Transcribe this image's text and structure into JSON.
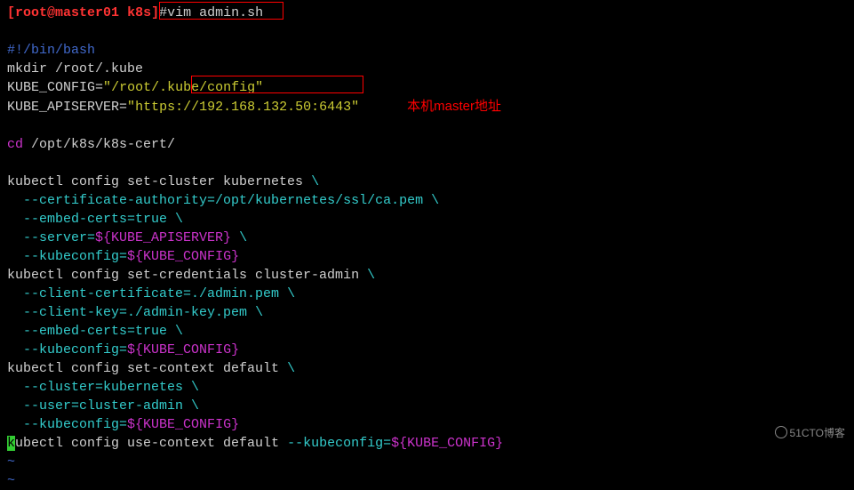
{
  "prompt": {
    "user": "root",
    "at": "@",
    "host": "master01",
    "dir": " k8s",
    "bracket_close": "]",
    "hash": "#",
    "command": "vim admin.sh"
  },
  "annotation": "本机master地址",
  "script": {
    "shebang": "#!/bin/bash",
    "mkdir": "mkdir /root/.kube",
    "kube_config_assign": {
      "var": "KUBE_CONFIG",
      "eq": "=",
      "q1": "\"",
      "val": "/root/.kube/config",
      "q2": "\""
    },
    "kube_apiserver_assign": {
      "var": "KUBE_APISERVER",
      "eq": "=",
      "q1": "\"",
      "proto": "https://",
      "addr": "192.168.132.50:6443",
      "q2": "\""
    },
    "cd": {
      "cmd": "cd",
      "path": " /opt/k8s/k8s-cert/"
    },
    "cluster": {
      "l1": {
        "cmd": "kubectl config set-cluster kubernetes ",
        "bs": "\\"
      },
      "l2": {
        "pad": "  ",
        "opt": "--certificate-authority=/opt/kubernetes/ssl/ca.pem ",
        "bs": "\\"
      },
      "l3": {
        "pad": "  ",
        "opt": "--embed-certs=true ",
        "bs": "\\"
      },
      "l4": {
        "pad": "  ",
        "opt": "--server=",
        "var": "${KUBE_APISERVER}",
        "sp": " ",
        "bs": "\\"
      },
      "l5": {
        "pad": "  ",
        "opt": "--kubeconfig=",
        "var": "${KUBE_CONFIG}"
      }
    },
    "creds": {
      "l1": {
        "cmd": "kubectl config set-credentials cluster-admin ",
        "bs": "\\"
      },
      "l2": {
        "pad": "  ",
        "opt": "--client-certificate=./admin.pem ",
        "bs": "\\"
      },
      "l3": {
        "pad": "  ",
        "opt": "--client-key=./admin-key.pem ",
        "bs": "\\"
      },
      "l4": {
        "pad": "  ",
        "opt": "--embed-certs=true ",
        "bs": "\\"
      },
      "l5": {
        "pad": "  ",
        "opt": "--kubeconfig=",
        "var": "${KUBE_CONFIG}"
      }
    },
    "context": {
      "l1": {
        "cmd": "kubectl config set-context default ",
        "bs": "\\"
      },
      "l2": {
        "pad": "  ",
        "opt": "--cluster=kubernetes ",
        "bs": "\\"
      },
      "l3": {
        "pad": "  ",
        "opt": "--user=cluster-admin ",
        "bs": "\\"
      },
      "l4": {
        "pad": "  ",
        "opt": "--kubeconfig=",
        "var": "${KUBE_CONFIG}"
      }
    },
    "use_context": {
      "cursor": "k",
      "cmd": "ubectl config use-context default ",
      "opt": "--kubeconfig=",
      "var": "${KUBE_CONFIG}"
    }
  },
  "tilde": "~",
  "watermark": "51CTO博客"
}
